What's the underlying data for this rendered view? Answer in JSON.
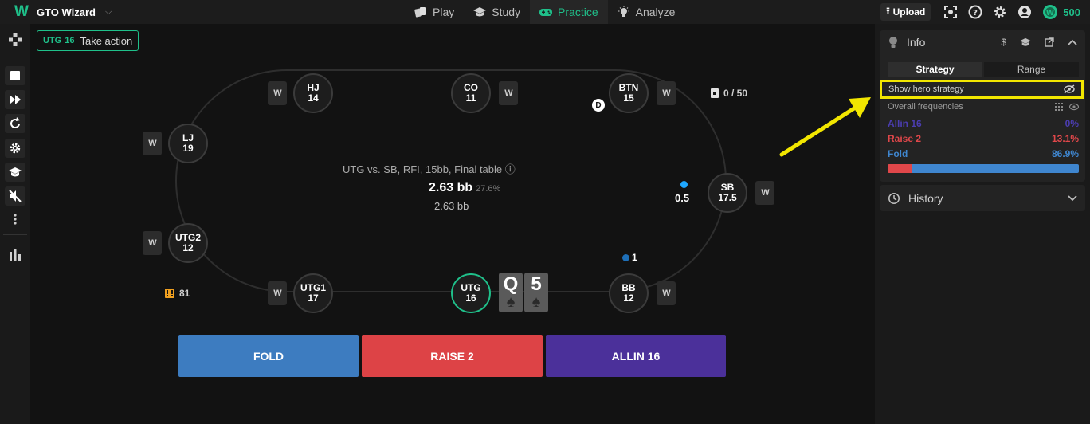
{
  "header": {
    "app_name": "GTO Wizard",
    "nav": [
      {
        "label": "Play",
        "icon": "cards-icon"
      },
      {
        "label": "Study",
        "icon": "graduation-cap-icon"
      },
      {
        "label": "Practice",
        "icon": "gamepad-icon"
      },
      {
        "label": "Analyze",
        "icon": "lightbulb-icon"
      }
    ],
    "upload_label": "Upload",
    "coins": "500"
  },
  "badge": {
    "position": "UTG",
    "stack": "16",
    "text": "Take action"
  },
  "seats": {
    "hj": {
      "pos": "HJ",
      "stack": "14"
    },
    "co": {
      "pos": "CO",
      "stack": "11"
    },
    "btn": {
      "pos": "BTN",
      "stack": "15"
    },
    "lj": {
      "pos": "LJ",
      "stack": "19"
    },
    "sb": {
      "pos": "SB",
      "stack": "17.5"
    },
    "utg2": {
      "pos": "UTG2",
      "stack": "12"
    },
    "utg1": {
      "pos": "UTG1",
      "stack": "17"
    },
    "utg": {
      "pos": "UTG",
      "stack": "16"
    },
    "bb": {
      "pos": "BB",
      "stack": "12"
    }
  },
  "cardback_label": "W",
  "hero_cards": [
    {
      "rank": "Q",
      "suit": "♠"
    },
    {
      "rank": "5",
      "suit": "♠"
    }
  ],
  "center": {
    "scenario": "UTG vs. SB, RFI, 15bb, Final table ⓘ",
    "pot": "2.63 bb",
    "pot_pct": "27.6%",
    "pot_sub": "2.63 bb"
  },
  "hand_counter": "0 / 50",
  "tourney_counter": "81",
  "dealer_label": "D",
  "bets": {
    "sb": "0.5",
    "bb": "1"
  },
  "actions": [
    {
      "label": "FOLD",
      "color": "#3d7cc0"
    },
    {
      "label": "RAISE 2",
      "color": "#dd4346"
    },
    {
      "label": "ALLIN 16",
      "color": "#4b309a"
    }
  ],
  "panel": {
    "info_title": "Info",
    "tabs": [
      "Strategy",
      "Range"
    ],
    "show_hero": "Show hero strategy",
    "overall": "Overall frequencies",
    "freqs": [
      {
        "label": "Allin 16",
        "value": "0%",
        "color": "#4b3db0"
      },
      {
        "label": "Raise 2",
        "value": "13.1%",
        "color": "#e0474a"
      },
      {
        "label": "Fold",
        "value": "86.9%",
        "color": "#3f86cf"
      }
    ],
    "freq_fractions": {
      "raise": 0.131,
      "fold": 0.869
    },
    "history_title": "History"
  },
  "colors": {
    "accent": "#1fc08a",
    "highlight": "#f2e600"
  }
}
